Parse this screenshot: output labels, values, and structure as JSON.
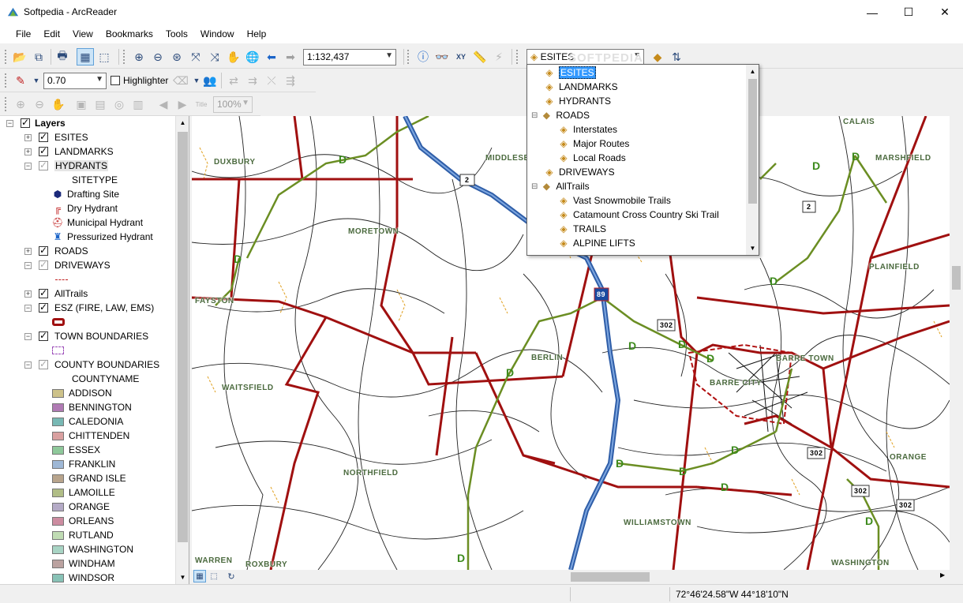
{
  "window": {
    "title": "Softpedia - ArcReader",
    "minimize_glyph": "—",
    "maximize_glyph": "☐",
    "close_glyph": "✕"
  },
  "menu": [
    "File",
    "Edit",
    "View",
    "Bookmarks",
    "Tools",
    "Window",
    "Help"
  ],
  "toolbar": {
    "scale_value": "1:132,437",
    "layer_combo_value": "ESITES",
    "line_width_value": "0.70",
    "highlighter_label": "Highlighter",
    "title_label": "Title",
    "zoom_value": "100%",
    "watermark": "SOFTPEDIA"
  },
  "toc": {
    "root_label": "Layers",
    "layers": [
      {
        "label": "ESITES",
        "checked": true
      },
      {
        "label": "LANDMARKS",
        "checked": true
      },
      {
        "label": "HYDRANTS",
        "checked": false
      },
      {
        "label": "SITETYPE"
      },
      {
        "label": "Drafting Site",
        "icon": "drafting-site-icon"
      },
      {
        "label": "Dry Hydrant",
        "icon": "dry-hydrant-icon"
      },
      {
        "label": "Municipal Hydrant",
        "icon": "municipal-hydrant-icon"
      },
      {
        "label": "Pressurized Hydrant",
        "icon": "pressurized-hydrant-icon"
      },
      {
        "label": "ROADS",
        "checked": true
      },
      {
        "label": "DRIVEWAYS",
        "checked": false
      },
      {
        "label": "AllTrails",
        "checked": true
      },
      {
        "label": "ESZ (FIRE, LAW, EMS)",
        "checked": true
      },
      {
        "label": "TOWN BOUNDARIES",
        "checked": true
      },
      {
        "label": "COUNTY BOUNDARIES",
        "checked": false
      },
      {
        "label": "COUNTYNAME"
      }
    ],
    "counties": [
      {
        "label": "ADDISON",
        "color": "#cdc28a"
      },
      {
        "label": "BENNINGTON",
        "color": "#b07ab4"
      },
      {
        "label": "CALEDONIA",
        "color": "#78b8b4"
      },
      {
        "label": "CHITTENDEN",
        "color": "#d9a0a0"
      },
      {
        "label": "ESSEX",
        "color": "#8ec89a"
      },
      {
        "label": "FRANKLIN",
        "color": "#9fb8d6"
      },
      {
        "label": "GRAND ISLE",
        "color": "#b8a48c"
      },
      {
        "label": "LAMOILLE",
        "color": "#b0bd86"
      },
      {
        "label": "ORANGE",
        "color": "#b4aac6"
      },
      {
        "label": "ORLEANS",
        "color": "#cc8ca0"
      },
      {
        "label": "RUTLAND",
        "color": "#c0dcb4"
      },
      {
        "label": "WASHINGTON",
        "color": "#a8d4c4"
      },
      {
        "label": "WINDHAM",
        "color": "#bba2a0"
      },
      {
        "label": "WINDSOR",
        "color": "#88c2b6"
      }
    ]
  },
  "dropdown": {
    "items": [
      {
        "label": "ESITES",
        "level": 0,
        "selected": true
      },
      {
        "label": "LANDMARKS",
        "level": 0
      },
      {
        "label": "HYDRANTS",
        "level": 0
      },
      {
        "label": "ROADS",
        "level": 0,
        "group": true
      },
      {
        "label": "Interstates",
        "level": 1
      },
      {
        "label": "Major Routes",
        "level": 1
      },
      {
        "label": "Local Roads",
        "level": 1
      },
      {
        "label": "DRIVEWAYS",
        "level": 0
      },
      {
        "label": "AllTrails",
        "level": 0,
        "group": true
      },
      {
        "label": "Vast Snowmobile Trails",
        "level": 1
      },
      {
        "label": "Catamount Cross Country Ski Trail",
        "level": 1
      },
      {
        "label": "TRAILS",
        "level": 1
      },
      {
        "label": "ALPINE LIFTS",
        "level": 1
      }
    ]
  },
  "map": {
    "town_labels": [
      "DUXBURY",
      "MIDDLESEX",
      "MORETOWN",
      "FAYSTON",
      "WAITSFIELD",
      "BERLIN",
      "NORTHFIELD",
      "WILLIAMSTOWN",
      "BARRE TOWN",
      "BARRE CITY",
      "ORANGE",
      "PLAINFIELD",
      "MARSHFIELD",
      "CALAIS",
      "WARREN",
      "ROXBURY",
      "WASHINGTON"
    ],
    "route_shields": [
      "2",
      "89",
      "302",
      "302",
      "302",
      "302",
      "2"
    ]
  },
  "status": {
    "coordinates": "72°46'24.58\"W  44°18'10\"N"
  },
  "colors": {
    "town_boundary": "#a01010",
    "interstate": "#2f5ea8",
    "trail": "#6b8e23",
    "local_road": "#222222",
    "stream": "#e0a020",
    "selection": "#3399ff"
  }
}
